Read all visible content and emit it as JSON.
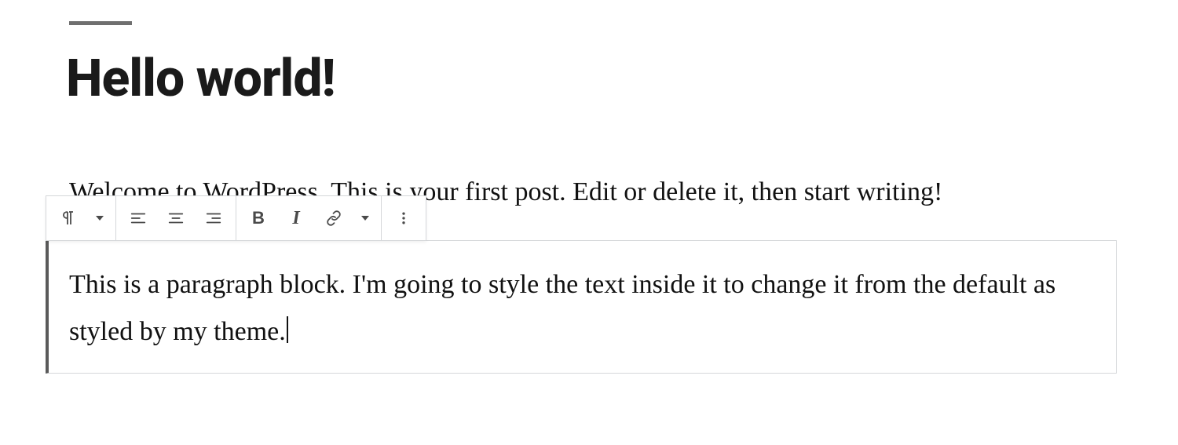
{
  "post": {
    "title": "Hello world!",
    "intro": "Welcome to WordPress. This is your first post. Edit or delete it, then start writing!",
    "block_text": "This is a paragraph block. I'm going to style the text inside it to change it from the default as styled by my theme."
  },
  "toolbar": {
    "block_type_icon": "pilcrow",
    "align_left": "align-left",
    "align_center": "align-center",
    "align_right": "align-right",
    "bold": "B",
    "italic": "I",
    "link": "link",
    "more_inline": "dropdown",
    "more_options": "kebab"
  }
}
